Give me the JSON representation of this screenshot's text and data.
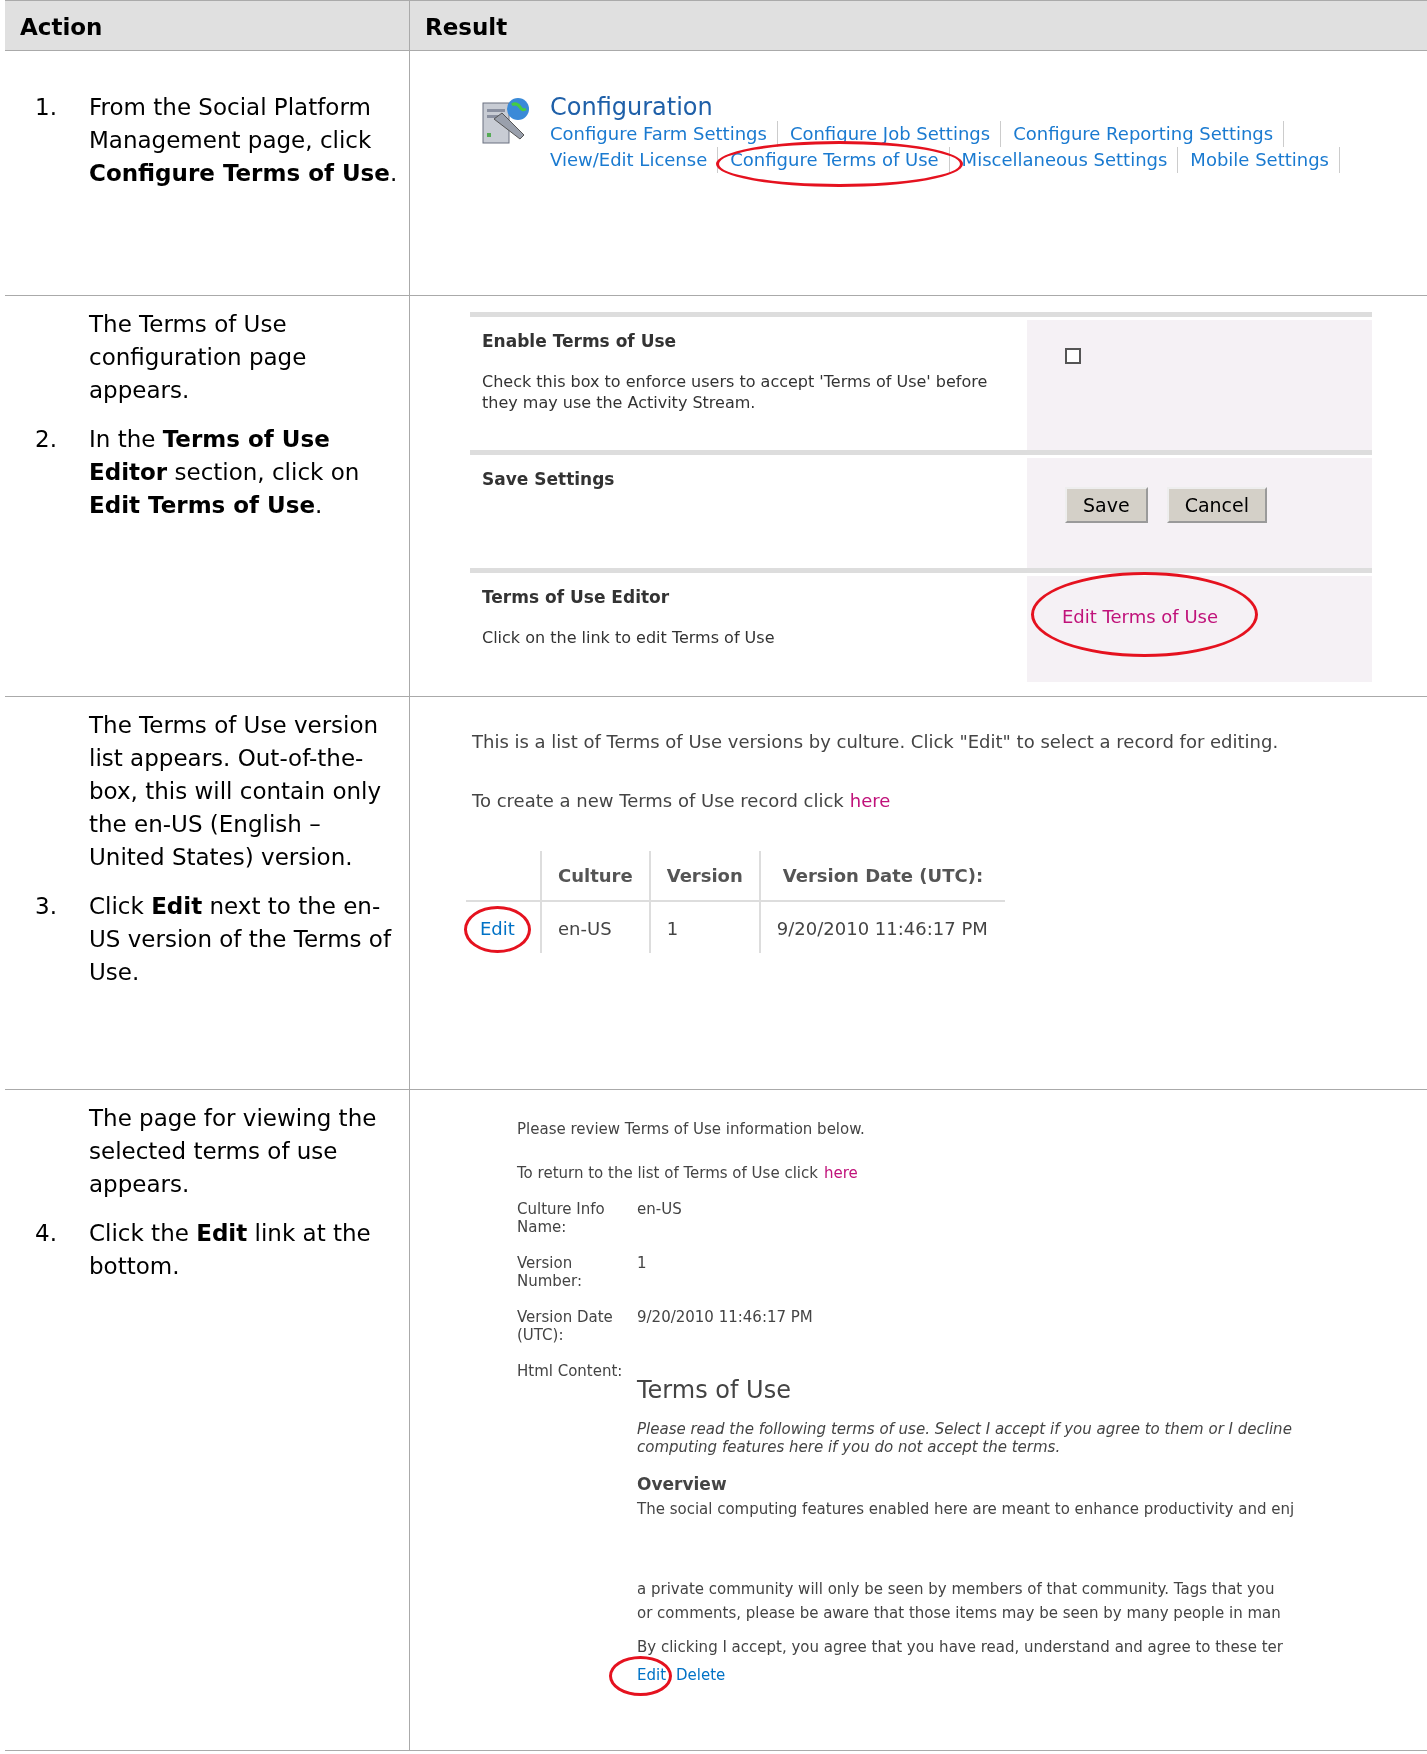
{
  "header": [
    "Action",
    "Result"
  ],
  "rows": [
    {
      "steps": [
        {
          "number": "1.",
          "text": "From the Social Platform Management page, click **Configure Terms of Use**."
        }
      ],
      "result": {
        "kind": "config_links",
        "title": "Configuration",
        "lines": [
          [
            {
              "label": "Configure Farm Settings",
              "circled": false
            },
            {
              "label": "Configure Job Settings",
              "circled": false
            },
            {
              "label": "Configure Reporting Settings",
              "circled": false
            }
          ],
          [
            {
              "label": "View/Edit License",
              "circled": false
            },
            {
              "label": "Configure Terms of Use",
              "circled": true
            },
            {
              "label": "Miscellaneous Settings",
              "circled": false
            },
            {
              "label": "Mobile Settings",
              "circled": false
            }
          ]
        ]
      }
    },
    {
      "steps": [
        {
          "text": "The Terms of Use configuration page appears."
        },
        {
          "number": "2.",
          "text": "In the **Terms of Use Editor** section, click on **Edit Terms of Use**."
        }
      ],
      "result": {
        "kind": "settings_form",
        "sections": [
          {
            "title": "Enable Terms of Use",
            "description": "Check this box to enforce users to accept 'Terms of Use' before they may use the Activity Stream.",
            "control": {
              "kind": "checkbox",
              "checked": false
            }
          },
          {
            "title": "Save Settings",
            "control": {
              "kind": "buttons",
              "buttons": [
                "Save",
                "Cancel"
              ]
            }
          },
          {
            "title": "Terms of Use Editor",
            "description": "Click on the link to edit Terms of Use",
            "control": {
              "kind": "link",
              "label": "Edit Terms of Use",
              "circled": true
            }
          }
        ]
      }
    },
    {
      "steps": [
        {
          "text": "The Terms of Use version list appears. Out-of-the-box, this will contain only the en-US (English – United States) version."
        },
        {
          "number": "3.",
          "text": "Click **Edit** next to the en-US version of the Terms of Use."
        }
      ],
      "result": {
        "kind": "version_list",
        "intro": "This is a list of Terms of Use versions by culture. Click \"Edit\" to select a record for editing.",
        "create_text": "To create a new Terms of Use record click",
        "create_link": "here",
        "columns": [
          "Culture",
          "Version",
          "Version Date (UTC):"
        ],
        "records": [
          {
            "action": "Edit",
            "circled": true,
            "cells": [
              "en-US",
              "1",
              "9/20/2010 11:46:17 PM"
            ]
          }
        ]
      }
    },
    {
      "steps": [
        {
          "text": "The page for viewing the selected terms of use appears."
        },
        {
          "number": "4.",
          "text": "Click the **Edit** link at the bottom."
        }
      ],
      "result": {
        "kind": "view_page",
        "intro": "Please review Terms of Use information below.",
        "return_text": "To return to the list of Terms of Use click",
        "return_link": "here",
        "fields": [
          {
            "label": "Culture Info Name:",
            "value": "en-US"
          },
          {
            "label": "Version Number:",
            "value": "1"
          },
          {
            "label": "Version Date (UTC):",
            "value": "9/20/2010 11:46:17 PM"
          }
        ],
        "content_label": "Html Content:",
        "content_heading": "Terms of Use",
        "content_intro": "Please read the following terms of use. Select I accept if you agree to them or I decline computing features here if you do not accept the terms.",
        "content_subheading": "Overview",
        "content_clipped": "The social computing features enabled here are meant to enhance productivity and enj",
        "content_lines": [
          "a private community will only be seen by members of that community. Tags that you",
          "or comments, please be aware that those items may be seen by many people in man"
        ],
        "content_last": "By clicking I accept, you agree that you have read, understand and agree to these ter",
        "actions": [
          {
            "label": "Edit",
            "circled": true
          },
          {
            "label": "Delete",
            "circled": false
          }
        ]
      }
    }
  ]
}
